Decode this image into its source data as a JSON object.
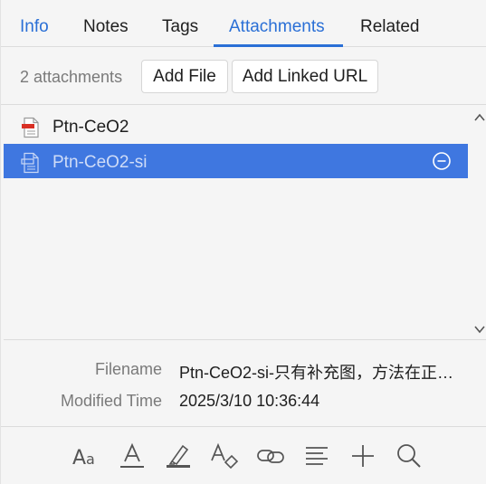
{
  "tabs": [
    {
      "label": "Info"
    },
    {
      "label": "Notes"
    },
    {
      "label": "Tags"
    },
    {
      "label": "Attachments"
    },
    {
      "label": "Related"
    }
  ],
  "active_tab": "Attachments",
  "toolbar": {
    "count_label": "2 attachments",
    "add_file_label": "Add File",
    "add_linked_url_label": "Add Linked URL"
  },
  "attachments": [
    {
      "name": "Ptn-CeO2",
      "icon": "pdf-file-icon",
      "selected": false
    },
    {
      "name": "Ptn-CeO2-si",
      "icon": "document-file-icon",
      "selected": true
    }
  ],
  "details": {
    "filename_label": "Filename",
    "filename_value": "Ptn-CeO2-si-只有补充图，方法在正…",
    "modified_label": "Modified Time",
    "modified_value": "2025/3/10 10:36:44"
  },
  "bottom_tools": [
    "font-size-icon",
    "text-color-icon",
    "highlighter-icon",
    "clear-format-icon",
    "link-icon",
    "align-icon",
    "plus-icon",
    "search-icon"
  ],
  "colors": {
    "accent": "#2a6fd6",
    "selection": "#3f77e0",
    "pdf_red": "#d93025"
  }
}
